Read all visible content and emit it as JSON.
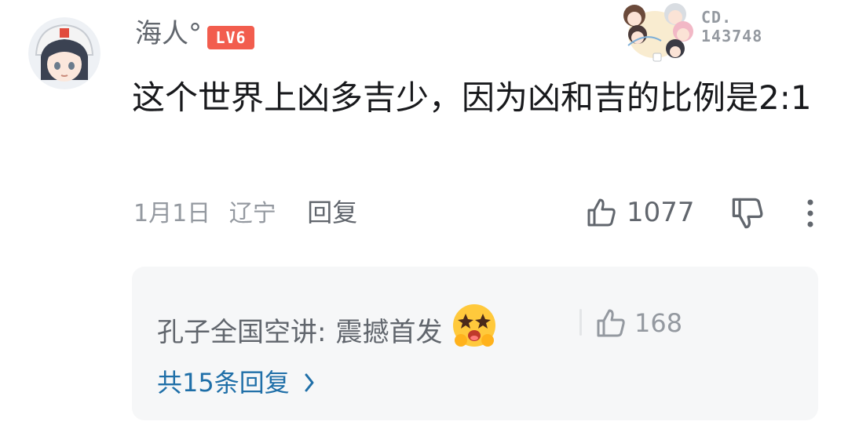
{
  "comment": {
    "username": "海人°",
    "level": "LV6",
    "fan_badge": {
      "code_line1": "CD.",
      "code_line2": "143748"
    },
    "text": "这个世界上凶多吉少，因为凶和吉的比例是2:1",
    "date": "1月1日",
    "location": "辽宁",
    "reply_label": "回复",
    "like_count": "1077",
    "icons": {
      "like": "thumbs-up-icon",
      "dislike": "thumbs-down-icon",
      "more": "more-vertical-icon"
    }
  },
  "reply_preview": {
    "author": "孔子全国空讲",
    "separator": ":",
    "text": "震撼首发",
    "emoji": "starstruck-face-emoji",
    "like_count": "168",
    "view_all_label": "共15条回复"
  },
  "colors": {
    "accent_link": "#1f6fa8",
    "level_badge": "#f25d4e",
    "secondary_text": "#9499a0",
    "panel_bg": "#f6f7f8"
  }
}
